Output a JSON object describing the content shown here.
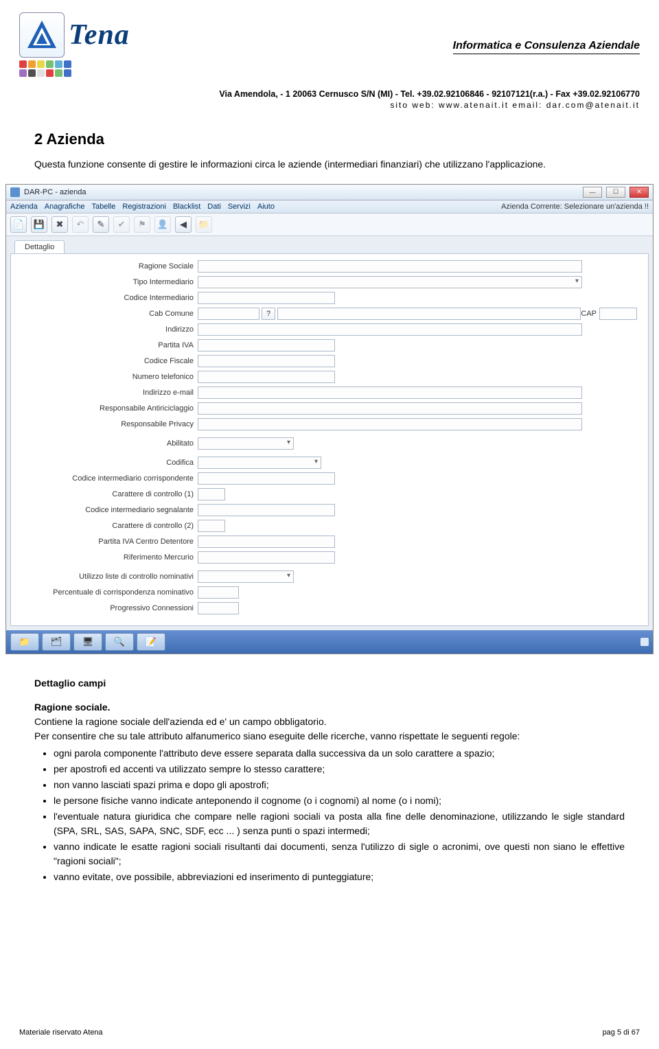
{
  "header": {
    "brand": "Tena",
    "tagline": "Informatica e Consulenza Aziendale",
    "address": "Via Amendola, - 1 20063 Cernusco S/N (MI) - Tel. +39.02.92106846 - 92107121(r.a.) - Fax +39.02.92106770",
    "contact": "sito web: www.atenait.it    email: dar.com@atenait.it"
  },
  "section": {
    "title": "2  Azienda",
    "intro": "Questa funzione consente di gestire le informazioni circa le aziende (intermediari finanziari) che utilizzano l'applicazione."
  },
  "app": {
    "title": "DAR-PC - azienda",
    "status": "Azienda Corrente: Selezionare un'azienda !!",
    "menu": [
      "Azienda",
      "Anagrafiche",
      "Tabelle",
      "Registrazioni",
      "Blacklist",
      "Dati",
      "Servizi",
      "Aiuto"
    ],
    "tab": "Dettaglio",
    "fields": {
      "ragione_sociale": "Ragione Sociale",
      "tipo_intermediario": "Tipo Intermediario",
      "codice_intermediario": "Codice Intermediario",
      "cab_comune": "Cab Comune",
      "cap": "CAP",
      "indirizzo": "Indirizzo",
      "partita_iva": "Partita IVA",
      "codice_fiscale": "Codice Fiscale",
      "numero_telefonico": "Numero telefonico",
      "indirizzo_email": "Indirizzo e-mail",
      "responsabile_antiriciclaggio": "Responsabile Antiriciclaggio",
      "responsabile_privacy": "Responsabile Privacy",
      "abilitato": "Abilitato",
      "codifica": "Codifica",
      "cod_int_corr": "Codice intermediario corrispondente",
      "car_ctrl_1": "Carattere di controllo (1)",
      "cod_int_segn": "Codice intermediario segnalante",
      "car_ctrl_2": "Carattere di controllo (2)",
      "piva_centro_det": "Partita IVA Centro Detentore",
      "rif_mercurio": "Riferimento Mercurio",
      "utilizzo_liste": "Utilizzo liste di controllo nominativi",
      "perc_corr": "Percentuale di corrispondenza nominativo",
      "progr_conn": "Progressivo Connessioni"
    },
    "lookup_btn": "?"
  },
  "body": {
    "h1": "Dettaglio campi",
    "h2": "Ragione sociale.",
    "p1": "Contiene la ragione sociale dell'azienda ed e' un campo obbligatorio.",
    "p2": "Per consentire che su tale attributo alfanumerico siano eseguite delle ricerche, vanno rispettate le seguenti regole:",
    "bullets": [
      "ogni parola componente l'attributo deve essere separata dalla successiva da un solo carattere a spazio;",
      "per apostrofi ed accenti va utilizzato sempre lo stesso carattere;",
      "non vanno lasciati spazi prima e dopo gli apostrofi;",
      "le persone fisiche vanno indicate anteponendo il cognome (o i cognomi) al nome (o i nomi);",
      "l'eventuale natura giuridica che compare nelle ragioni sociali va posta alla fine delle denominazione, utilizzando le sigle standard (SPA, SRL, SAS, SAPA, SNC, SDF, ecc ... ) senza punti o spazi intermedi;",
      "vanno indicate le esatte ragioni sociali risultanti dai documenti, senza l'utilizzo di sigle o acronimi, ove questi non siano le effettive \"ragioni sociali\";",
      "vanno evitate, ove possibile, abbreviazioni ed inserimento di punteggiature;"
    ]
  },
  "footer": {
    "left": "Materiale riservato Atena",
    "right": "pag 5 di 67"
  }
}
